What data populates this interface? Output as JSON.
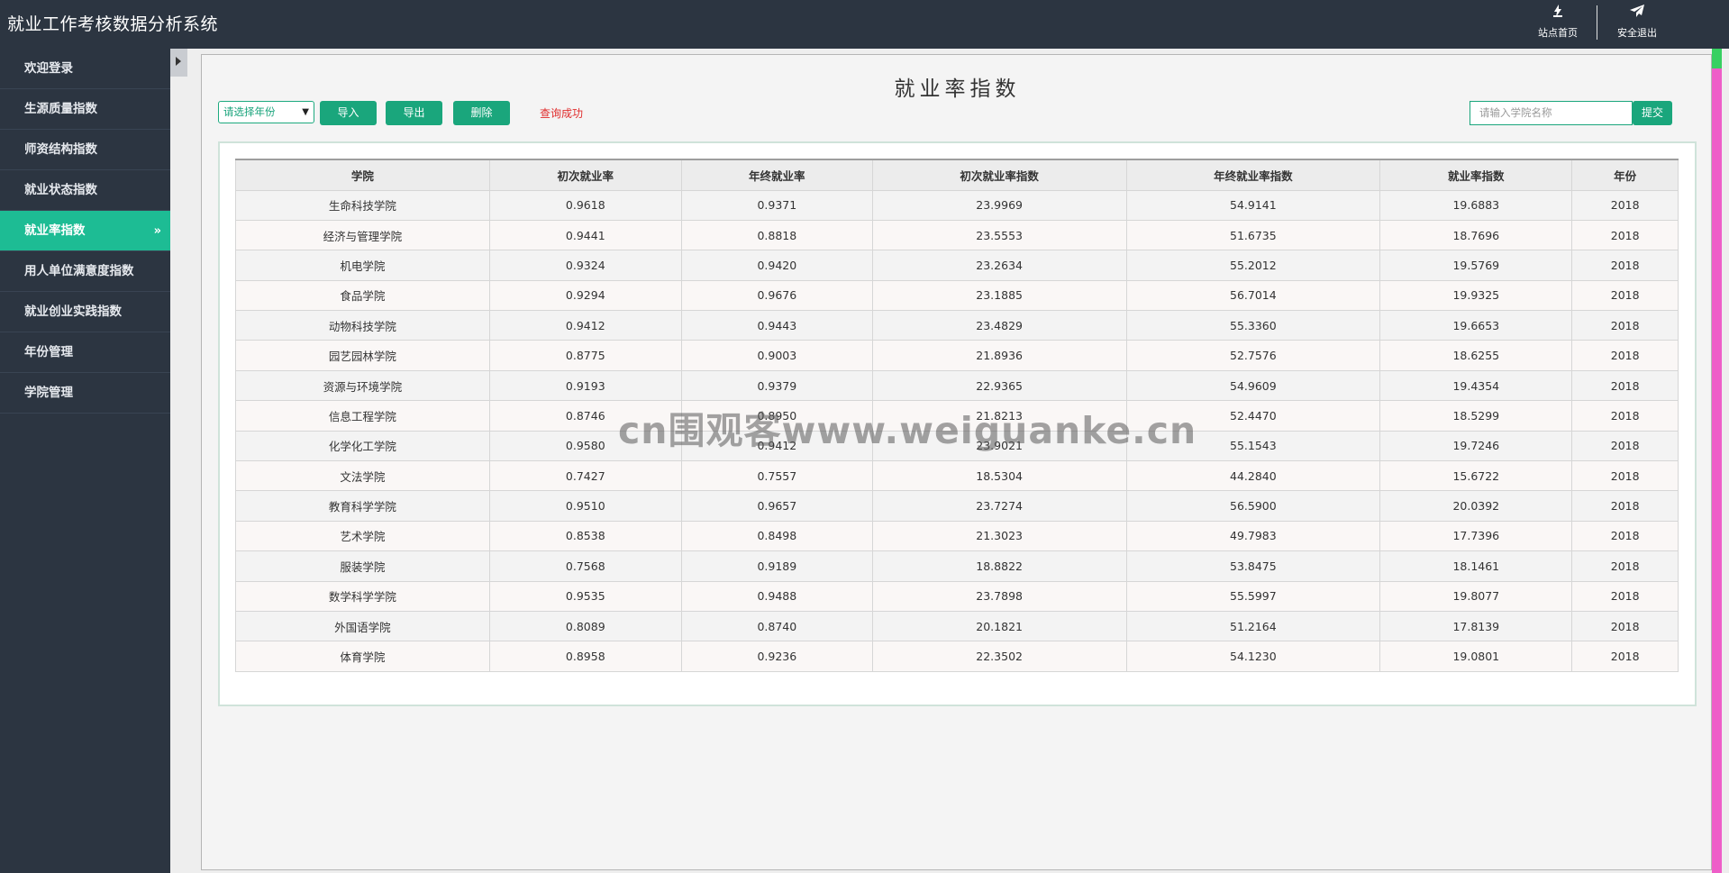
{
  "header": {
    "app_title": "就业工作考核数据分析系统",
    "home_label": "站点首页",
    "logout_label": "安全退出"
  },
  "sidebar": {
    "items": [
      {
        "label": "欢迎登录"
      },
      {
        "label": "生源质量指数"
      },
      {
        "label": "师资结构指数"
      },
      {
        "label": "就业状态指数"
      },
      {
        "label": "就业率指数",
        "active": true,
        "arrow": "»"
      },
      {
        "label": "用人单位满意度指数"
      },
      {
        "label": "就业创业实践指数"
      },
      {
        "label": "年份管理"
      },
      {
        "label": "学院管理"
      }
    ]
  },
  "main": {
    "page_title": "就业率指数",
    "year_select": "请选择年份",
    "import_label": "导入",
    "export_label": "导出",
    "delete_label": "删除",
    "status_message": "查询成功",
    "search_placeholder": "请输入学院名称",
    "submit_label": "提交"
  },
  "table": {
    "columns": [
      "学院",
      "初次就业率",
      "年终就业率",
      "初次就业率指数",
      "年终就业率指数",
      "就业率指数",
      "年份"
    ],
    "rows": [
      [
        "生命科技学院",
        "0.9618",
        "0.9371",
        "23.9969",
        "54.9141",
        "19.6883",
        "2018"
      ],
      [
        "经济与管理学院",
        "0.9441",
        "0.8818",
        "23.5553",
        "51.6735",
        "18.7696",
        "2018"
      ],
      [
        "机电学院",
        "0.9324",
        "0.9420",
        "23.2634",
        "55.2012",
        "19.5769",
        "2018"
      ],
      [
        "食品学院",
        "0.9294",
        "0.9676",
        "23.1885",
        "56.7014",
        "19.9325",
        "2018"
      ],
      [
        "动物科技学院",
        "0.9412",
        "0.9443",
        "23.4829",
        "55.3360",
        "19.6653",
        "2018"
      ],
      [
        "园艺园林学院",
        "0.8775",
        "0.9003",
        "21.8936",
        "52.7576",
        "18.6255",
        "2018"
      ],
      [
        "资源与环境学院",
        "0.9193",
        "0.9379",
        "22.9365",
        "54.9609",
        "19.4354",
        "2018"
      ],
      [
        "信息工程学院",
        "0.8746",
        "0.8950",
        "21.8213",
        "52.4470",
        "18.5299",
        "2018"
      ],
      [
        "化学化工学院",
        "0.9580",
        "0.9412",
        "23.9021",
        "55.1543",
        "19.7246",
        "2018"
      ],
      [
        "文法学院",
        "0.7427",
        "0.7557",
        "18.5304",
        "44.2840",
        "15.6722",
        "2018"
      ],
      [
        "教育科学学院",
        "0.9510",
        "0.9657",
        "23.7274",
        "56.5900",
        "20.0392",
        "2018"
      ],
      [
        "艺术学院",
        "0.8538",
        "0.8498",
        "21.3023",
        "49.7983",
        "17.7396",
        "2018"
      ],
      [
        "服装学院",
        "0.7568",
        "0.9189",
        "18.8822",
        "53.8475",
        "18.1461",
        "2018"
      ],
      [
        "数学科学学院",
        "0.9535",
        "0.9488",
        "23.7898",
        "55.5997",
        "19.8077",
        "2018"
      ],
      [
        "外国语学院",
        "0.8089",
        "0.8740",
        "20.1821",
        "51.2164",
        "17.8139",
        "2018"
      ],
      [
        "体育学院",
        "0.8958",
        "0.9236",
        "22.3502",
        "54.1230",
        "19.0801",
        "2018"
      ]
    ]
  },
  "watermark": "cn围观客www.weiguanke.cn",
  "icons": {
    "home": "home-icon",
    "logout": "paper-plane-icon",
    "collapse": "caret-right-icon"
  },
  "colors": {
    "sidebar_bg": "#2c3541",
    "accent": "#1dbc94",
    "button": "#1aa67c",
    "status_red": "#e02c2c"
  }
}
